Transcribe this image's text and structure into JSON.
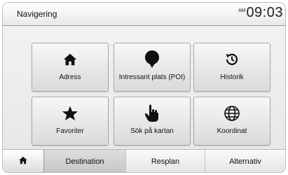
{
  "header": {
    "title": "Navigering",
    "clock_ampm": "AM",
    "clock_time": "09:03"
  },
  "tiles": [
    {
      "label": "Adress",
      "icon": "home-icon"
    },
    {
      "label": "Intressant plats (POI)",
      "icon": "map-pin-icon"
    },
    {
      "label": "Historik",
      "icon": "history-icon"
    },
    {
      "label": "Favoriter",
      "icon": "star-icon"
    },
    {
      "label": "Sök på kartan",
      "icon": "hand-pointer-icon"
    },
    {
      "label": "Koordinat",
      "icon": "globe-icon"
    }
  ],
  "tabs": {
    "home_icon": "home-icon",
    "items": [
      {
        "label": "Destination",
        "active": true
      },
      {
        "label": "Resplan",
        "active": false
      },
      {
        "label": "Alternativ",
        "active": false
      }
    ]
  },
  "colors": {
    "text": "#111111",
    "tile_top": "#f7f7f7",
    "tile_bottom": "#dadada",
    "active_tab": "#c6c6c6"
  }
}
